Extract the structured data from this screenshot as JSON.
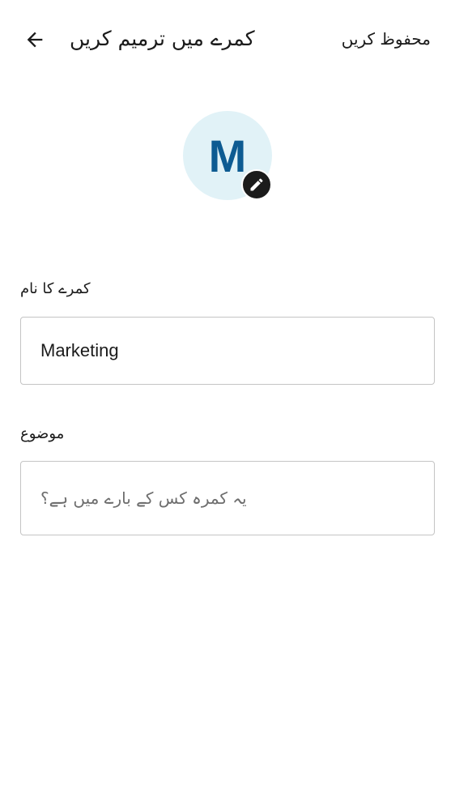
{
  "header": {
    "title": "کمرے میں ترمیم کریں",
    "save_label": "محفوظ کریں",
    "back_icon": "arrow-left-icon"
  },
  "room": {
    "avatar_initial": "M",
    "avatar_bg_color": "#e1f2f7",
    "avatar_text_color": "#0d5b92",
    "edit_icon": "pencil-icon"
  },
  "form": {
    "name_label": "کمرے کا نام",
    "name_value": "Marketing",
    "topic_label": "موضوع",
    "topic_value": "",
    "topic_placeholder": "یہ کمرہ کس کے بارے میں ہے؟"
  }
}
